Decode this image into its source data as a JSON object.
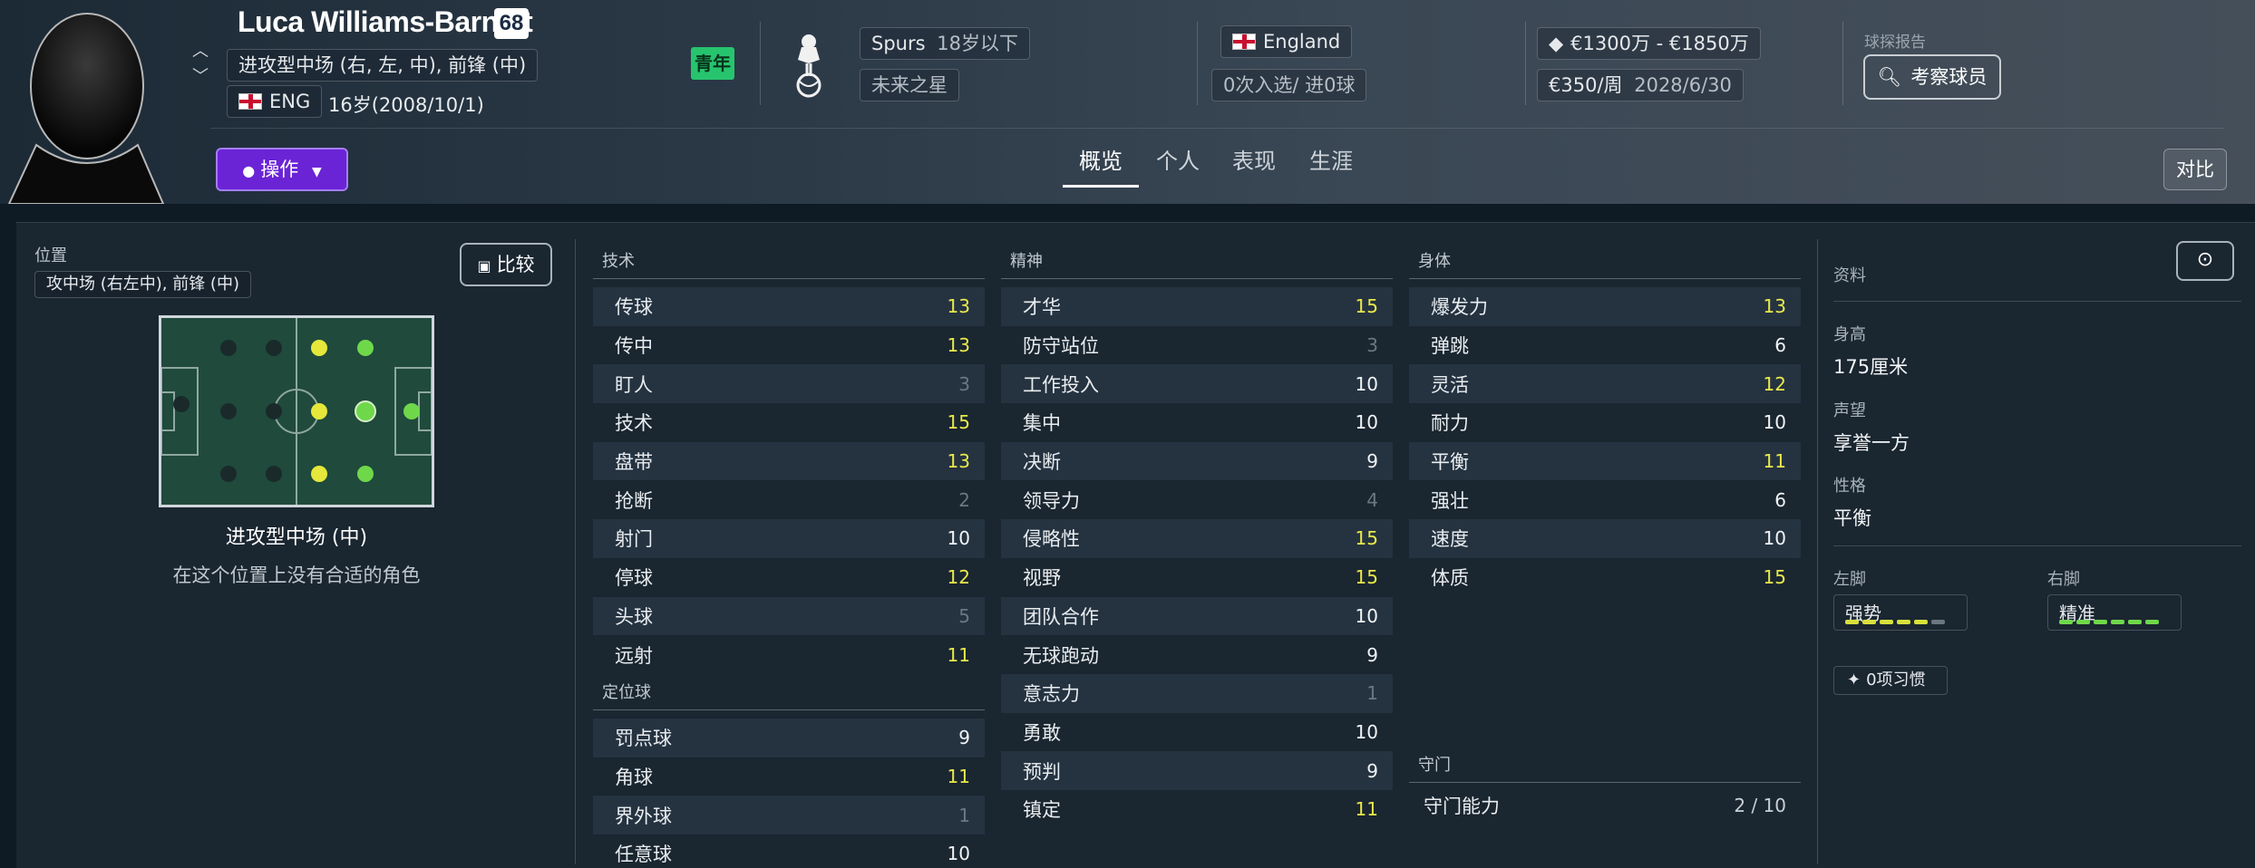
{
  "player": {
    "name": "Luca Williams-Barnett",
    "ca": "68",
    "positions": "进攻型中场 (右, 左, 中), 前锋 (中)",
    "nation_code": "ENG",
    "age_dob": "16岁(2008/10/1)",
    "youth_badge": "青年"
  },
  "club": {
    "name": "Spurs",
    "team": "18岁以下",
    "status": "未来之星"
  },
  "intl": {
    "nation": "England",
    "caps": "0次入选/ 进0球"
  },
  "contract": {
    "value": "€1300万 - €1850万",
    "wage": "€350/周",
    "expires": "2028/6/30"
  },
  "scout": {
    "label": "球探报告",
    "button": "考察球员"
  },
  "actions": {
    "ops": "操作",
    "compare": "对比",
    "compare_small": "比较"
  },
  "tabs": [
    {
      "label": "概览",
      "active": true
    },
    {
      "label": "个人",
      "active": false
    },
    {
      "label": "表现",
      "active": false
    },
    {
      "label": "生涯",
      "active": false
    }
  ],
  "position_panel": {
    "title": "位置",
    "tag": "攻中场 (右左中), 前锋 (中)",
    "selected": "进攻型中场 (中)",
    "note": "在这个位置上没有合适的角色"
  },
  "technical": {
    "title": "技术",
    "rows": [
      {
        "name": "传球",
        "value": "13",
        "tone": "y"
      },
      {
        "name": "传中",
        "value": "13",
        "tone": "y"
      },
      {
        "name": "盯人",
        "value": "3",
        "tone": "g"
      },
      {
        "name": "技术",
        "value": "15",
        "tone": "y"
      },
      {
        "name": "盘带",
        "value": "13",
        "tone": "y"
      },
      {
        "name": "抢断",
        "value": "2",
        "tone": "g"
      },
      {
        "name": "射门",
        "value": "10",
        "tone": "w"
      },
      {
        "name": "停球",
        "value": "12",
        "tone": "y"
      },
      {
        "name": "头球",
        "value": "5",
        "tone": "g"
      },
      {
        "name": "远射",
        "value": "11",
        "tone": "y"
      }
    ]
  },
  "setpieces": {
    "title": "定位球",
    "rows": [
      {
        "name": "罚点球",
        "value": "9",
        "tone": "w"
      },
      {
        "name": "角球",
        "value": "11",
        "tone": "y"
      },
      {
        "name": "界外球",
        "value": "1",
        "tone": "g"
      },
      {
        "name": "任意球",
        "value": "10",
        "tone": "w"
      }
    ]
  },
  "mental": {
    "title": "精神",
    "rows": [
      {
        "name": "才华",
        "value": "15",
        "tone": "y"
      },
      {
        "name": "防守站位",
        "value": "3",
        "tone": "g"
      },
      {
        "name": "工作投入",
        "value": "10",
        "tone": "w"
      },
      {
        "name": "集中",
        "value": "10",
        "tone": "w"
      },
      {
        "name": "决断",
        "value": "9",
        "tone": "w"
      },
      {
        "name": "领导力",
        "value": "4",
        "tone": "g"
      },
      {
        "name": "侵略性",
        "value": "15",
        "tone": "y"
      },
      {
        "name": "视野",
        "value": "15",
        "tone": "y"
      },
      {
        "name": "团队合作",
        "value": "10",
        "tone": "w"
      },
      {
        "name": "无球跑动",
        "value": "9",
        "tone": "w"
      },
      {
        "name": "意志力",
        "value": "1",
        "tone": "g"
      },
      {
        "name": "勇敢",
        "value": "10",
        "tone": "w"
      },
      {
        "name": "预判",
        "value": "9",
        "tone": "w"
      },
      {
        "name": "镇定",
        "value": "11",
        "tone": "y"
      }
    ]
  },
  "physical": {
    "title": "身体",
    "rows": [
      {
        "name": "爆发力",
        "value": "13",
        "tone": "y"
      },
      {
        "name": "弹跳",
        "value": "6",
        "tone": "w"
      },
      {
        "name": "灵活",
        "value": "12",
        "tone": "y"
      },
      {
        "name": "耐力",
        "value": "10",
        "tone": "w"
      },
      {
        "name": "平衡",
        "value": "11",
        "tone": "y"
      },
      {
        "name": "强壮",
        "value": "6",
        "tone": "w"
      },
      {
        "name": "速度",
        "value": "10",
        "tone": "w"
      },
      {
        "name": "体质",
        "value": "15",
        "tone": "y"
      }
    ]
  },
  "goalkeeping": {
    "title": "守门",
    "label": "守门能力",
    "value": "2 / 10"
  },
  "info": {
    "title": "资料",
    "height_label": "身高",
    "height": "175厘米",
    "rep_label": "声望",
    "rep": "享誉一方",
    "personality_label": "性格",
    "personality": "平衡",
    "left_foot_label": "左脚",
    "left_foot": "强势",
    "right_foot_label": "右脚",
    "right_foot": "精准",
    "habits": "0项习惯"
  },
  "colors": {
    "accent": "#6b23d6",
    "good": "#e9e94a",
    "youth": "#27c46e",
    "pitch": "#1f4a3c",
    "dot_yellow": "#e5e83a",
    "dot_green": "#6fd84a"
  }
}
